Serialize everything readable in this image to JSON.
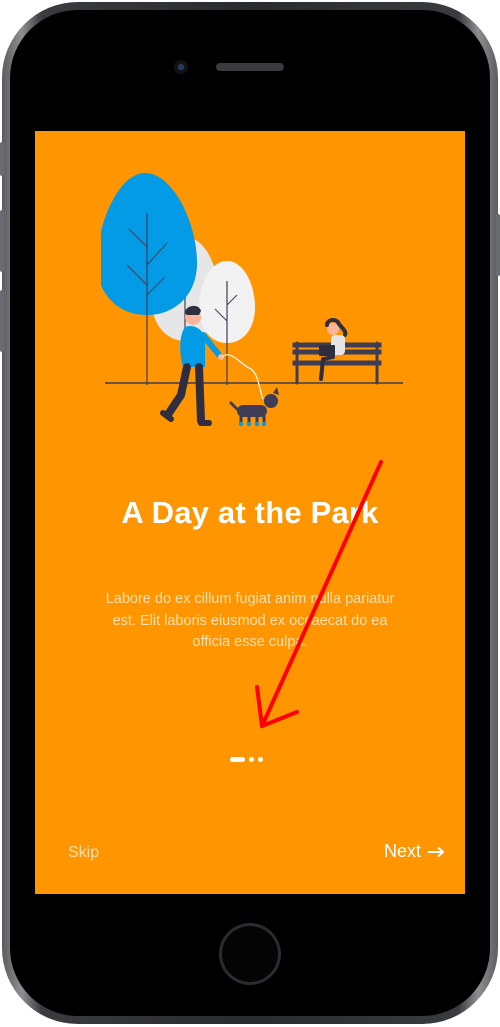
{
  "onboarding": {
    "title": "A Day at the Park",
    "description": "Labore do ex cillum fugiat anim nulla pariatur est. Elit laboris eiusmod ex occaecat do ea officia esse culpa.",
    "pager": {
      "total": 3,
      "current": 1
    },
    "skip_label": "Skip",
    "next_label": "Next",
    "next_icon": "arrow-right-icon"
  },
  "colors": {
    "screen_background": "#ff9500",
    "title_text": "#ffffff",
    "body_text": "#ffe0b0",
    "tree_blue": "#039be5",
    "annotation_arrow": "#ff0000"
  }
}
